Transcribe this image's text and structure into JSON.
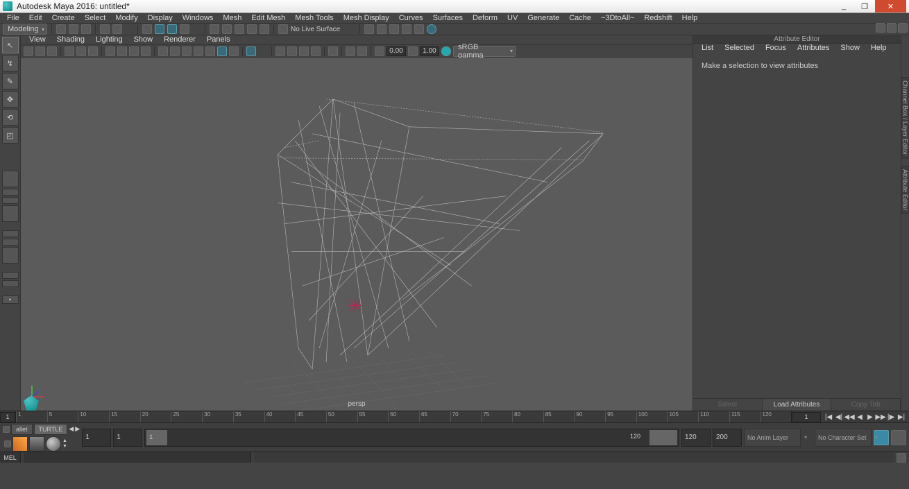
{
  "window": {
    "title": "Autodesk Maya 2016: untitled*",
    "min_label": "_",
    "max_label": "❐",
    "close_label": "✕"
  },
  "menubar": [
    "File",
    "Edit",
    "Create",
    "Select",
    "Modify",
    "Display",
    "Windows",
    "Mesh",
    "Edit Mesh",
    "Mesh Tools",
    "Mesh Display",
    "Curves",
    "Surfaces",
    "Deform",
    "UV",
    "Generate",
    "Cache",
    "~3DtoAll~",
    "Redshift",
    "Help"
  ],
  "workspace_dropdown": "Modeling",
  "no_live_surface": "No Live Surface",
  "panel_menu": [
    "View",
    "Shading",
    "Lighting",
    "Show",
    "Renderer",
    "Panels"
  ],
  "panel_num1": "0.00",
  "panel_num2": "1.00",
  "colormgmt": "sRGB gamma",
  "camera_label": "persp",
  "attr": {
    "header": "Attribute Editor",
    "menu": [
      "List",
      "Selected",
      "Focus",
      "Attributes",
      "Show",
      "Help"
    ],
    "empty": "Make a selection to view attributes",
    "btn_select": "Select",
    "btn_load": "Load Attributes",
    "btn_copy": "Copy Tab"
  },
  "dock_tabs": [
    "Channel Box / Layer Editor",
    "Attribute Editor"
  ],
  "timeline": {
    "start_field": "1",
    "ticks": [
      1,
      5,
      10,
      15,
      20,
      25,
      30,
      35,
      40,
      45,
      50,
      55,
      60,
      65,
      70,
      75,
      80,
      85,
      90,
      95,
      100,
      105,
      110,
      115,
      120
    ],
    "current_field": "1"
  },
  "range": {
    "shelf_tab_left": "allet",
    "shelf_tab_active": "TURTLE",
    "start": "1",
    "end": "1",
    "end_display": "120",
    "range_end": "120",
    "total": "200",
    "anim_layer": "No Anim Layer",
    "char_set": "No Character Set"
  },
  "cmd": {
    "label": "MEL"
  },
  "icons": {
    "select_tool": "↖",
    "lasso_tool": "↯",
    "paint_tool": "✎",
    "move_tool": "✥",
    "rotate_tool": "⟲",
    "scale_tool": "◰"
  },
  "playback": [
    "|◀",
    "◀|",
    "◀◀",
    "◀",
    "▶",
    "▶▶",
    "|▶",
    "▶|"
  ]
}
